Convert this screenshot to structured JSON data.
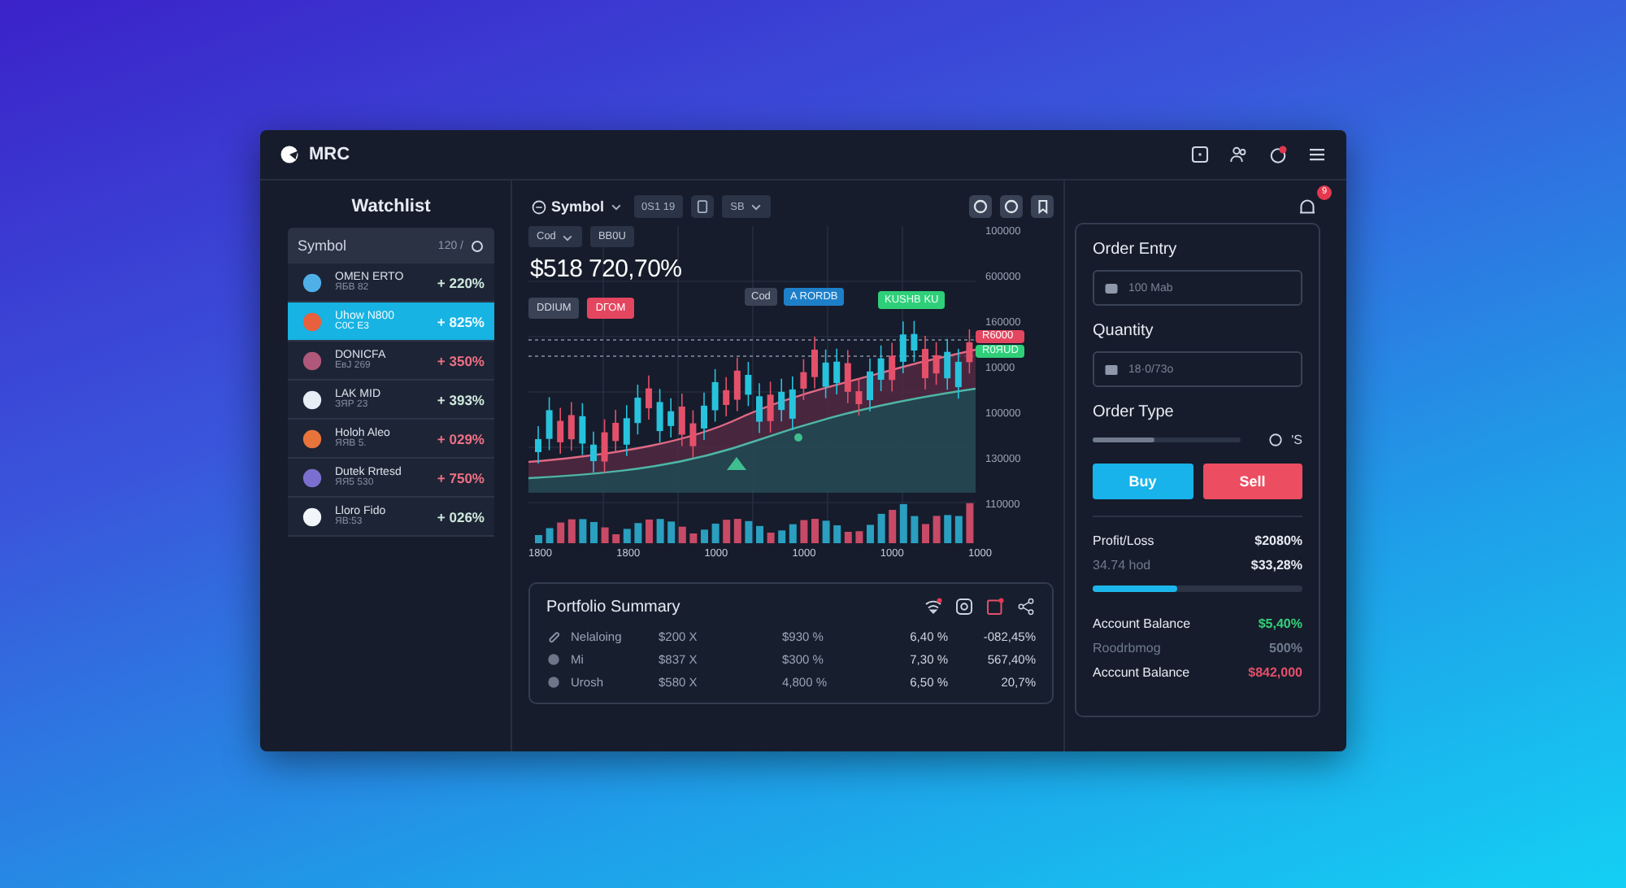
{
  "header": {
    "app_name": "MRC",
    "notification_dot": true
  },
  "watchlist": {
    "title": "Watchlist",
    "header_label": "Symbol",
    "header_meta": "120 /",
    "items": [
      {
        "name": "OMEN ERTO",
        "sub": "ЯБВ 82",
        "change": "+ 220%",
        "kind": "gain",
        "color": "#4fb0e8",
        "selected": false
      },
      {
        "name": "Uhow N800",
        "sub": "C0C E3",
        "change": "+ 825%",
        "kind": "gain",
        "color": "#e8603c",
        "selected": true
      },
      {
        "name": "DONICFA",
        "sub": "EвJ 269",
        "change": "+ 350%",
        "kind": "loss",
        "color": "#b0587a",
        "selected": false
      },
      {
        "name": "LAK MID",
        "sub": "ЗЯР 23",
        "change": "+ 393%",
        "kind": "gain",
        "color": "#e8eef6",
        "selected": false
      },
      {
        "name": "Holoh Aleo",
        "sub": "ЯЯВ 5.",
        "change": "+ 029%",
        "kind": "loss",
        "color": "#e8743c",
        "selected": false
      },
      {
        "name": "Dutek Rrtesd",
        "sub": "ЯЯ5 530",
        "change": "+ 750%",
        "kind": "loss",
        "color": "#7b6fd0",
        "selected": false
      },
      {
        "name": "Lloro Fido",
        "sub": "ЯВ:53",
        "change": "+ 026%",
        "kind": "gain",
        "color": "#f2f5fa",
        "selected": false
      }
    ]
  },
  "chart": {
    "symbol": "Symbol",
    "interval": "0S1 19",
    "timeframe": "SB",
    "chips": [
      "Cod",
      "BB0U"
    ],
    "price": "$518 720,70%",
    "buttons": [
      {
        "label": "DDIUM",
        "kind": "neutral"
      },
      {
        "label": "DГОМ",
        "kind": "sell"
      }
    ],
    "markers": [
      {
        "label": "Cod",
        "kind": "neutral"
      },
      {
        "label": "A RORDB",
        "kind": "info"
      },
      {
        "label": "KUSHB KU",
        "kind": "buy"
      }
    ],
    "price_tags": [
      {
        "label": "R6000",
        "kind": "sell"
      },
      {
        "label": "R0ЯUD",
        "kind": "buy"
      }
    ],
    "y_labels": [
      "100000",
      "600000",
      "160000",
      "10000",
      "100000",
      "130000",
      "110000"
    ],
    "x_labels": [
      "1800",
      "1800",
      "1000",
      "1000",
      "1000",
      "1000"
    ]
  },
  "portfolio": {
    "title": "Portfolio Summary",
    "rows": [
      {
        "name": "Nelaloing",
        "cells": [
          "$200 X",
          "$930 %",
          "6,40 %",
          "-082,45%"
        ]
      },
      {
        "name": "Mi",
        "cells": [
          "$837 X",
          "$300 %",
          "7,30 %",
          "567,40%"
        ]
      },
      {
        "name": "Urosh",
        "cells": [
          "$580 X",
          "4,800 %",
          "6,50 %",
          "20,7%"
        ]
      }
    ]
  },
  "order": {
    "bell_badge": "9",
    "title": "Order Entry",
    "entry_placeholder": "100 Mab",
    "quantity_label": "Quantity",
    "quantity_placeholder": "18·0/73o",
    "type_label": "Order Type",
    "order_type": {
      "level": 0.42
    },
    "type_suffix": "'S",
    "buy": "Buy",
    "sell": "Sell",
    "pnl_label": "Profit/Loss",
    "pnl_value": "$2080%",
    "sub_label": "34.74 hod",
    "sub_value": "$33,28%",
    "progress": {
      "level": 0.4
    },
    "balances": [
      {
        "label": "Account Balance",
        "value": "$5,40%",
        "kind": "positive"
      },
      {
        "label": "Roodrbmog",
        "value": "500%",
        "kind": "muted"
      },
      {
        "label": "Acccunt Balance",
        "value": "$842,000",
        "kind": "negative"
      }
    ]
  }
}
